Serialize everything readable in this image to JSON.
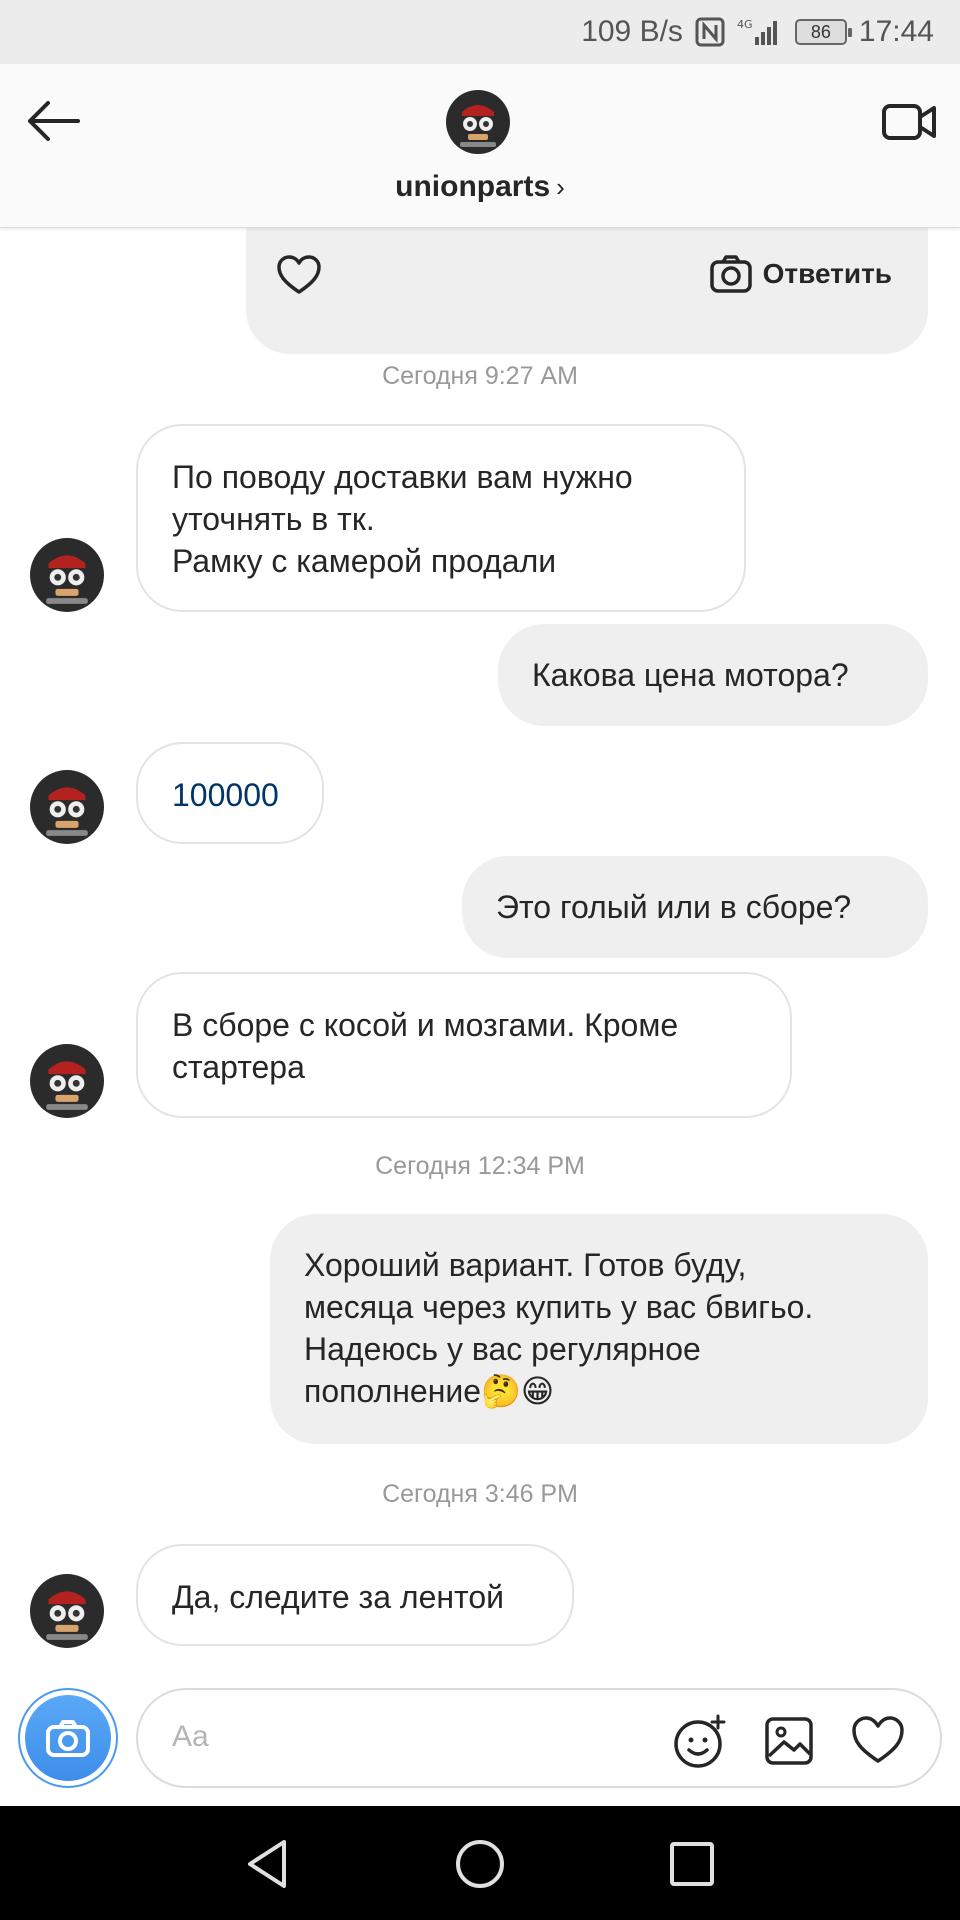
{
  "status_bar": {
    "speed": "109 B/s",
    "network": "4G",
    "battery": "86",
    "time": "17:44"
  },
  "header": {
    "username": "unionparts",
    "chevron": "›"
  },
  "shared_card": {
    "reply_label": "Ответить"
  },
  "messages": {
    "ts1": "Сегодня 9:27 AM",
    "m1_l1": "По поводу доставки вам нужно",
    "m1_l2": "уточнять в тк.",
    "m1_l3": "Рамку с камерой продали",
    "m2": "Какова цена мотора?",
    "m3": "100000",
    "m4": "Это голый или в сборе?",
    "m5_l1": "В сборе с косой и мозгами. Кроме",
    "m5_l2": "стартера",
    "ts2": "Сегодня 12:34 PM",
    "m6_l1": "Хороший вариант. Готов буду,",
    "m6_l2": "месяца через купить у вас бвигьо.",
    "m6_l3": "Надеюсь у вас регулярное",
    "m6_l4": "пополнение🤔😁",
    "ts3": "Сегодня 3:46 PM",
    "m7": "Да, следите за лентой"
  },
  "composer": {
    "placeholder": "Aa"
  },
  "colors": {
    "link_blue": "#003569",
    "camera_blue": "#3d8ee9",
    "outgoing_bubble": "#efefef",
    "timestamp_gray": "#999999"
  }
}
